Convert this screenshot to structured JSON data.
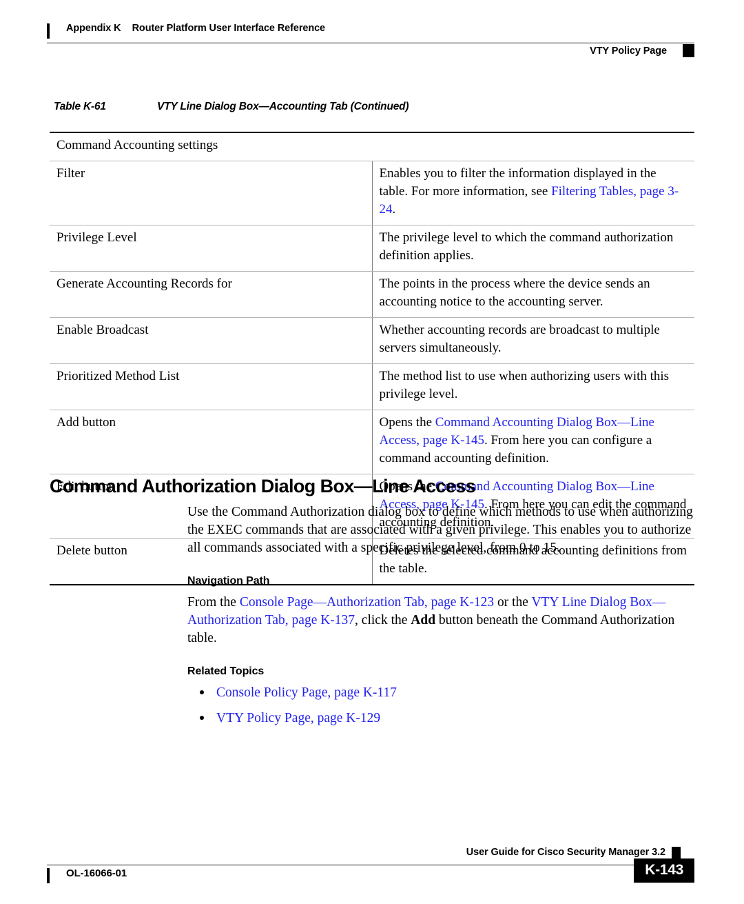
{
  "header": {
    "appendix": "Appendix K",
    "title": "Router Platform User Interface Reference",
    "running_head_right": "VTY Policy Page"
  },
  "table": {
    "caption_number": "Table K-61",
    "caption_title": "VTY Line Dialog Box—Accounting Tab (Continued)",
    "section_row": "Command Accounting settings",
    "rows": [
      {
        "label": "Filter",
        "desc_pre": "Enables you to filter the information displayed in the table. For more information, see ",
        "link": "Filtering Tables, page 3-24",
        "desc_post": "."
      },
      {
        "label": "Privilege Level",
        "desc_pre": "The privilege level to which the command authorization definition applies.",
        "link": "",
        "desc_post": ""
      },
      {
        "label": "Generate Accounting Records for",
        "desc_pre": "The points in the process where the device sends an accounting notice to the accounting server.",
        "link": "",
        "desc_post": ""
      },
      {
        "label": "Enable Broadcast",
        "desc_pre": "Whether accounting records are broadcast to multiple servers simultaneously.",
        "link": "",
        "desc_post": ""
      },
      {
        "label": "Prioritized Method List",
        "desc_pre": "The method list to use when authorizing users with this privilege level.",
        "link": "",
        "desc_post": ""
      },
      {
        "label": "Add button",
        "desc_pre": "Opens the ",
        "link": "Command Accounting Dialog Box—Line Access, page K-145",
        "desc_post": ". From here you can configure a command accounting definition."
      },
      {
        "label": "Edit button",
        "desc_pre": "Opens the ",
        "link": "Command Accounting Dialog Box—Line Access, page K-145",
        "desc_post": ". From here you can edit the command accounting definition."
      },
      {
        "label": "Delete button",
        "desc_pre": "Deletes the selected command accounting definitions from the table.",
        "link": "",
        "desc_post": ""
      }
    ]
  },
  "section": {
    "heading": "Command Authorization Dialog Box—Line Access",
    "intro": "Use the Command Authorization dialog box to define which methods to use when authorizing the EXEC commands that are associated with a given privilege. This enables you to authorize all commands associated with a specific privilege level, from 0 to 15.",
    "navigation_path": {
      "heading": "Navigation Path",
      "text_1": "From the ",
      "link_1": "Console Page—Authorization Tab, page K-123",
      "text_2": " or the ",
      "link_2": "VTY Line Dialog Box—Authorization Tab, page K-137",
      "text_3": ", click the ",
      "bold_1": "Add",
      "text_4": " button beneath the Command Authorization table."
    },
    "related_topics": {
      "heading": "Related Topics",
      "items": [
        "Console Policy Page, page K-117",
        "VTY Policy Page, page K-129"
      ]
    }
  },
  "footer": {
    "guide_title": "User Guide for Cisco Security Manager 3.2",
    "doc_id": "OL-16066-01",
    "page_number": "K-143"
  },
  "colors": {
    "link_blue": "#2222ee",
    "rule_gray": "#c8c8c8",
    "table_rule": "#b4b4b4"
  }
}
